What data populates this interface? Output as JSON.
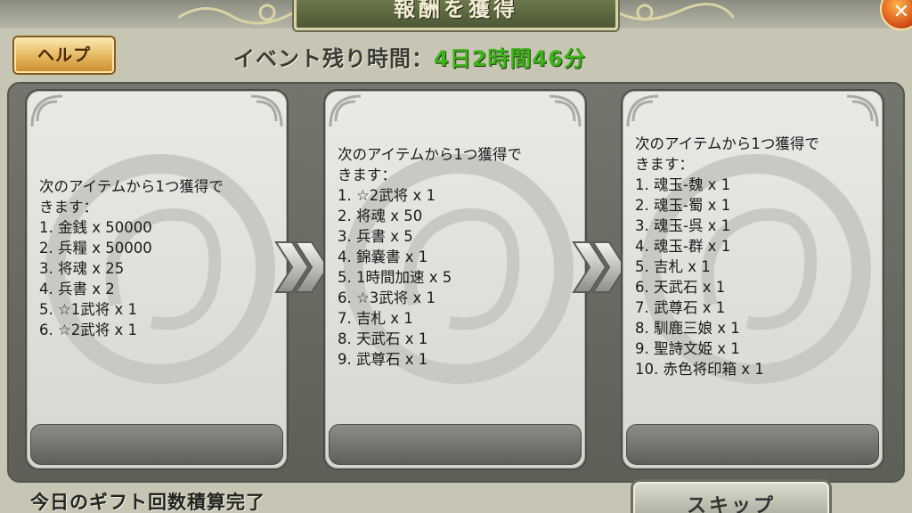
{
  "header": {
    "title": "報酬を獲得"
  },
  "help_button": {
    "label": "ヘルプ"
  },
  "event": {
    "label": "イベント残り時間：",
    "remaining": "4日2時間46分"
  },
  "stages": [
    {
      "intro": "次のアイテムから1つ獲得で\nきます：",
      "items": [
        "1. 金銭 x 50000",
        "2. 兵糧 x 50000",
        "3. 将魂 x 25",
        "4. 兵書 x 2",
        "5. ☆1武将 x 1",
        "6. ☆2武将 x 1"
      ]
    },
    {
      "intro": "次のアイテムから1つ獲得で\nきます：",
      "items": [
        "1. ☆2武将 x 1",
        "2. 将魂 x 50",
        "3. 兵書 x 5",
        "4. 錦嚢書 x 1",
        "5. 1時間加速 x 5",
        "6. ☆3武将 x 1",
        "7. 吉札 x 1",
        "8. 天武石 x 1",
        "9. 武尊石 x 1"
      ]
    },
    {
      "intro": "次のアイテムから1つ獲得で\nきます：",
      "items": [
        "1. 魂玉-魏 x 1",
        "2. 魂玉-蜀 x 1",
        "3. 魂玉-呉 x 1",
        "4. 魂玉-群 x 1",
        "5. 吉札 x 1",
        "6. 天武石 x 1",
        "7. 武尊石 x 1",
        "8. 馴鹿三娘 x 1",
        "9. 聖詩文姫 x 1",
        "10. 赤色将印箱 x 1"
      ]
    }
  ],
  "footer": {
    "gift_status": "今日のギフト回数積算完了",
    "skip_label": "スキップ"
  },
  "colors": {
    "timer_green": "#3fb21b",
    "help_gold": "#e5b65e",
    "panel_dark": "#5e5f57"
  },
  "icons": {
    "close": "close-icon",
    "arrow": "double-chevron-right-icon"
  }
}
